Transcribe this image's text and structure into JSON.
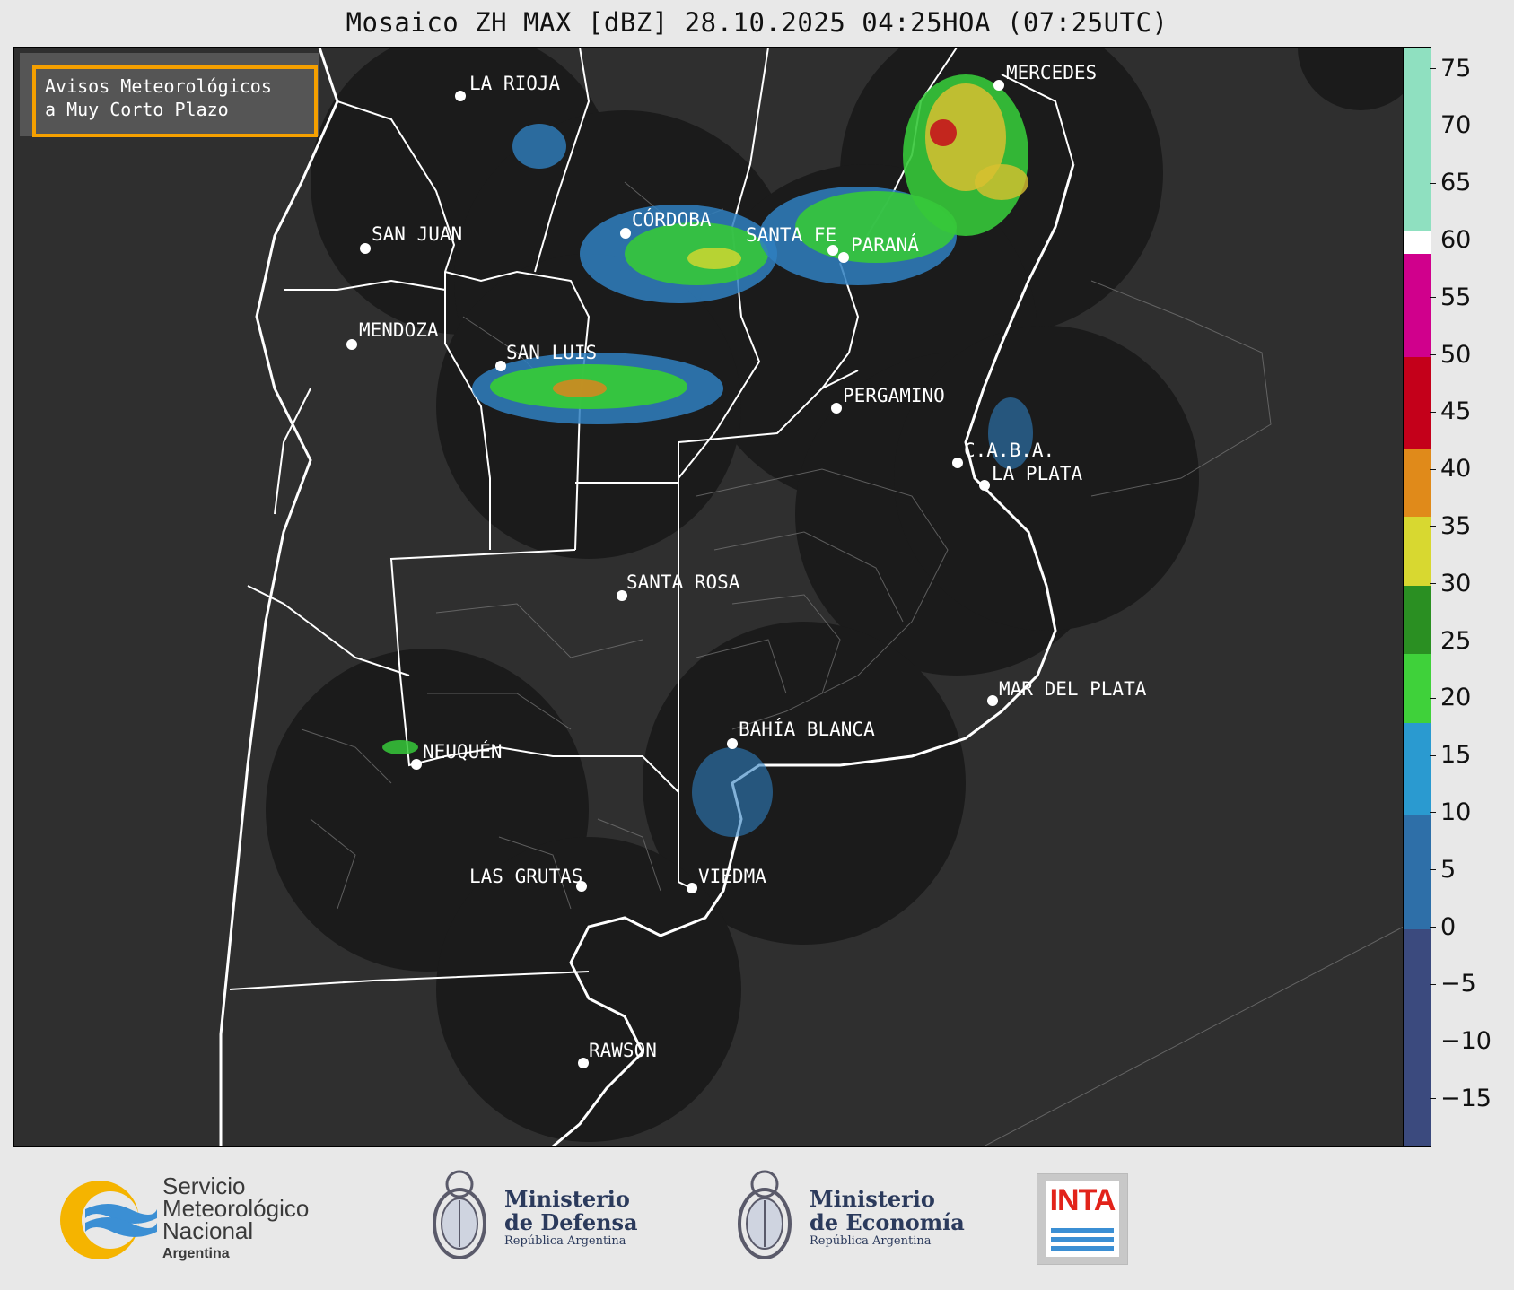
{
  "title": "Mosaico ZH MAX [dBZ] 28.10.2025 04:25HOA (07:25UTC)",
  "avisos": {
    "line1": "Avisos Meteorológicos",
    "line2": "a Muy Corto Plazo"
  },
  "cities": [
    {
      "name": "LA RIOJA",
      "id": "la-rioja"
    },
    {
      "name": "MERCEDES",
      "id": "mercedes"
    },
    {
      "name": "SAN JUAN",
      "id": "san-juan"
    },
    {
      "name": "CÓRDOBA",
      "id": "cordoba"
    },
    {
      "name": "SANTA FE",
      "id": "santa-fe"
    },
    {
      "name": "PARANÁ",
      "id": "parana"
    },
    {
      "name": "MENDOZA",
      "id": "mendoza"
    },
    {
      "name": "SAN LUIS",
      "id": "san-luis"
    },
    {
      "name": "PERGAMINO",
      "id": "pergamino"
    },
    {
      "name": "C.A.B.A.",
      "id": "caba"
    },
    {
      "name": "LA PLATA",
      "id": "la-plata"
    },
    {
      "name": "SANTA ROSA",
      "id": "santa-rosa"
    },
    {
      "name": "MAR DEL PLATA",
      "id": "mar-del-plata"
    },
    {
      "name": "BAHÍA BLANCA",
      "id": "bahia-blanca"
    },
    {
      "name": "NEUQUÉN",
      "id": "neuquen"
    },
    {
      "name": "LAS GRUTAS",
      "id": "las-grutas"
    },
    {
      "name": "VIEDMA",
      "id": "viedma"
    },
    {
      "name": "RAWSON",
      "id": "rawson"
    }
  ],
  "colorbar": {
    "min": -19,
    "max": 77,
    "ticks": [
      "75",
      "70",
      "65",
      "60",
      "55",
      "50",
      "45",
      "40",
      "35",
      "30",
      "25",
      "20",
      "15",
      "10",
      "5",
      "0",
      "−5",
      "−10",
      "−15"
    ],
    "bands": [
      {
        "from": -19,
        "to": 0,
        "color": "#3b4a7e"
      },
      {
        "from": 0,
        "to": 10,
        "color": "#2e6fa8"
      },
      {
        "from": 10,
        "to": 18,
        "color": "#2a9ad0"
      },
      {
        "from": 18,
        "to": 24,
        "color": "#3fd13a"
      },
      {
        "from": 24,
        "to": 30,
        "color": "#2a8f22"
      },
      {
        "from": 30,
        "to": 36,
        "color": "#d8d830"
      },
      {
        "from": 36,
        "to": 42,
        "color": "#e08a1a"
      },
      {
        "from": 42,
        "to": 50,
        "color": "#c4001a"
      },
      {
        "from": 50,
        "to": 59,
        "color": "#d0008c"
      },
      {
        "from": 59,
        "to": 61,
        "color": "#ffffff"
      },
      {
        "from": 61,
        "to": 77,
        "color": "#8fe0c0"
      }
    ]
  },
  "logos": {
    "smn": {
      "line1": "Servicio",
      "line2": "Meteorológico",
      "line3": "Nacional",
      "line4": "Argentina"
    },
    "defensa": {
      "line1": "Ministerio",
      "line2": "de Defensa",
      "sub": "República Argentina"
    },
    "economia": {
      "line1": "Ministerio",
      "line2": "de Economía",
      "sub": "República Argentina"
    },
    "inta": {
      "label": "INTA"
    }
  }
}
